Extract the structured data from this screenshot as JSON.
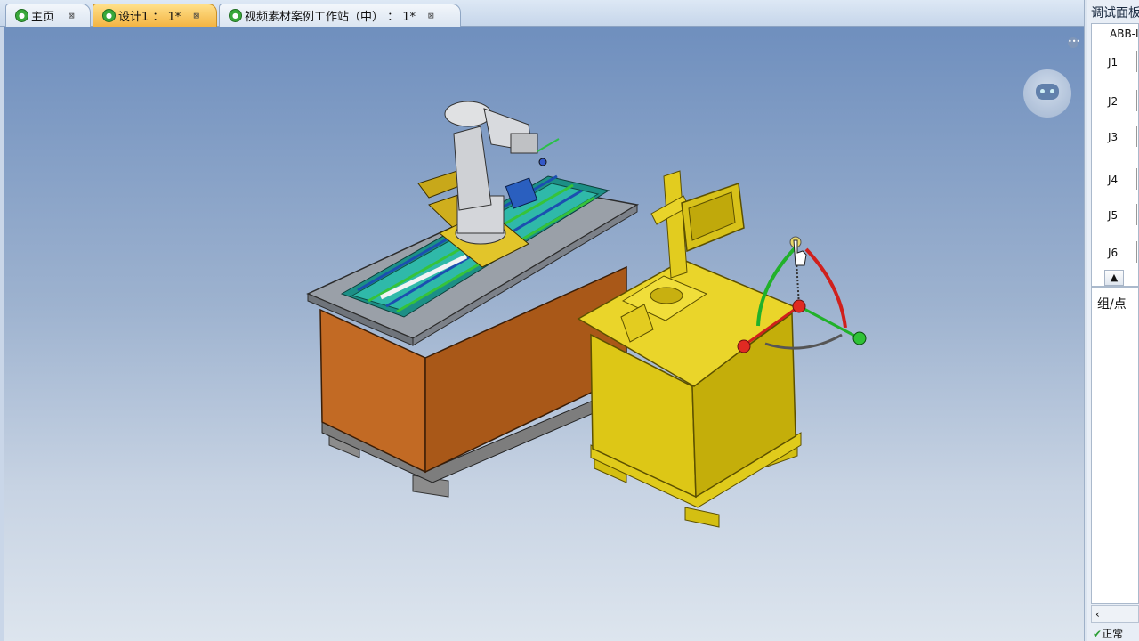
{
  "tabs": [
    {
      "label": "主页",
      "close": "⊠",
      "active": false,
      "icon": "app-logo-icon"
    },
    {
      "label": "设计1 ： 1*",
      "close": "⊠",
      "active": true,
      "icon": "app-logo-icon"
    },
    {
      "label": "视频素材案例工作站（中） ： 1*",
      "close": "⊠",
      "active": false,
      "icon": "app-logo-icon"
    }
  ],
  "right_panel": {
    "title": "调试面板",
    "robot_name": "ABB-IRB",
    "joints": [
      "J1",
      "J2",
      "J3",
      "J4",
      "J5",
      "J6"
    ],
    "up_button": "▲",
    "group_label": "组/点",
    "scroll_left": "‹",
    "status_text": "正常"
  },
  "viewport": {
    "background_top": "#6f8fbe",
    "background_bottom": "#dde5ee",
    "selected_color": "#d8c21a",
    "cabinet_color": "#b0621e",
    "assistant_icon": "robot-assistant-icon",
    "more_icon": "more-dots-icon"
  }
}
